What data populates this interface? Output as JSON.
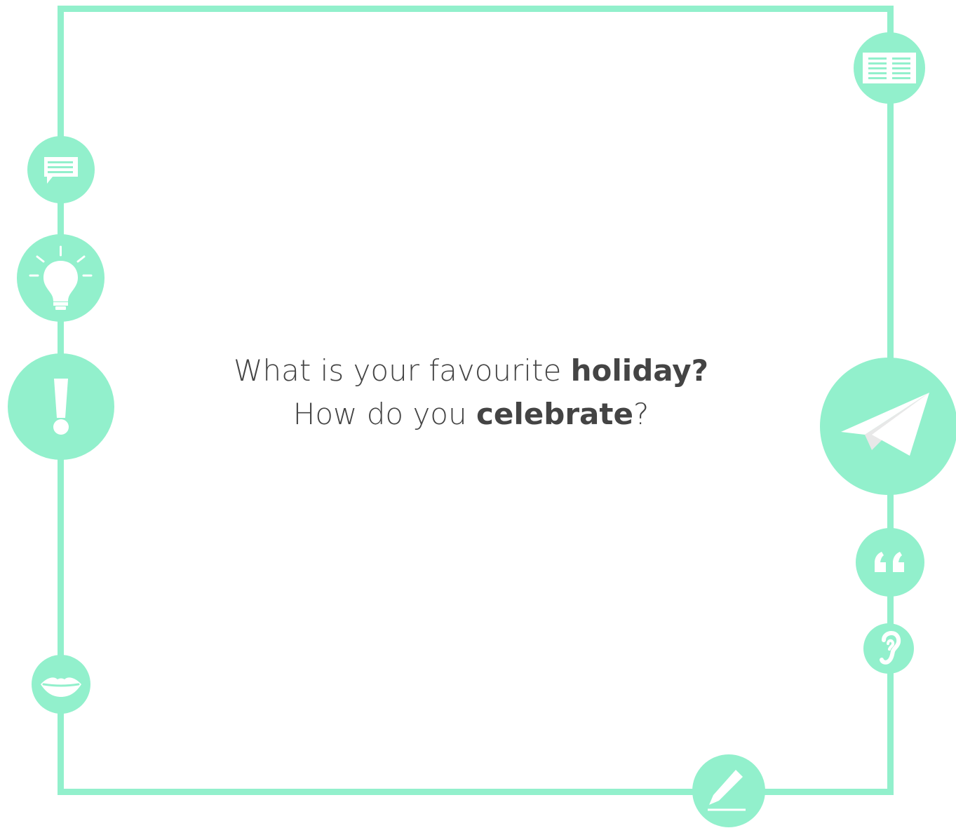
{
  "question": {
    "line1_normal": "What is your favourite ",
    "line1_bold": "holiday?",
    "line2_normal_start": "How do you ",
    "line2_bold": "celebrate",
    "line2_normal_end": "?"
  },
  "theme": {
    "accent": "#92f0cc",
    "icon_fill": "#ffffff",
    "text": "#444444",
    "background": "#ffffff"
  },
  "icons": [
    "newspaper-icon",
    "speech-bubble-icon",
    "lightbulb-icon",
    "exclamation-icon",
    "paper-plane-icon",
    "quote-icon",
    "ear-icon",
    "lips-icon",
    "pencil-icon"
  ]
}
